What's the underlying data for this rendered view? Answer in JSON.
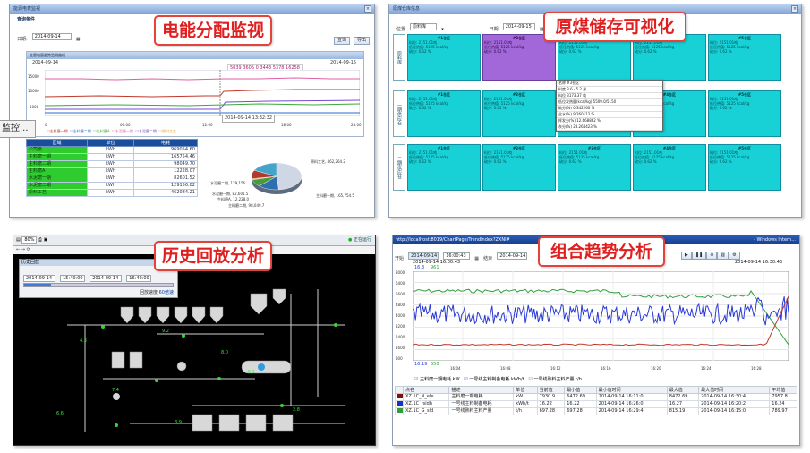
{
  "panel1": {
    "window_title": "能源电表监视",
    "sub_title": "查询条件",
    "date_label": "日期:",
    "date_value": "2014-09-14",
    "btn_query": "查询",
    "btn_export": "导出",
    "chart_title": "主要电量趋势监测曲线",
    "chart_date_left": "2014-09-14",
    "chart_date_right": "2014-09-15",
    "readout": "5839  3605  0  3443  5378  16258",
    "y_ticks": [
      "15000",
      "10000",
      "5000"
    ],
    "x_ticks": [
      "0",
      "06:00",
      "12:00",
      "18:00",
      "24:00"
    ],
    "cursor_time": "2014-09-14 13:32:32",
    "legend": [
      "主料磨一期",
      "主料磨二期",
      "生料磨A",
      "水泥磨一期",
      "水泥磨二期",
      "原料工艺"
    ],
    "table_headers": [
      "区域",
      "单位",
      "电耗"
    ],
    "table_rows": [
      {
        "name": "公司级",
        "unit": "kWh",
        "value": "969054.60"
      },
      {
        "name": "主料磨一期",
        "unit": "kWh",
        "value": "165754.46"
      },
      {
        "name": "主料磨二期",
        "unit": "kWh",
        "value": "98049.70"
      },
      {
        "name": "生料磨A",
        "unit": "kWh",
        "value": "12228.07"
      },
      {
        "name": "水泥磨一期",
        "unit": "kWh",
        "value": "82601.52"
      },
      {
        "name": "水泥磨二期",
        "unit": "kWh",
        "value": "129156.82"
      },
      {
        "name": "原料工艺",
        "unit": "kWh",
        "value": "462084.21"
      }
    ],
    "pie_labels": [
      "原料工艺, 462,264.2",
      "水泥磨二期, 129,156",
      "水泥磨一期, 82,601.5",
      "生料磨A, 12,228.0",
      "主料磨二期, 98,049.7",
      "主料磨一期, 165,754.5"
    ],
    "pie_colors": [
      "#cfd6e4",
      "#2f6fb0",
      "#4a9a3e",
      "#e0a22a",
      "#b03a2e",
      "#47a4c9"
    ],
    "pie_values": [
      462264.2,
      129156,
      82601.5,
      12228.0,
      98049.7,
      165754.5
    ],
    "callout": "电能分配监视"
  },
  "side_tab": "监控...",
  "panel2": {
    "window_title": "原煤仓库信息",
    "label_site": "位置",
    "site_value": "原料库",
    "label_date": "日期",
    "date_value": "2014-09-15",
    "btn": "查询",
    "callout": "原煤储存可视化",
    "row_headers": [
      "原料库",
      "一期供应仓",
      "二期供应仓"
    ],
    "cells": [
      [
        "#1仓区",
        "#2仓区",
        "#3仓区",
        "#4仓区",
        "#5仓区"
      ],
      [
        "#1仓区",
        "#2仓区",
        "#3仓区",
        "#4仓区",
        "#5仓区"
      ],
      [
        "#1仓区",
        "#2仓区",
        "#3仓区",
        "#4仓区",
        "#5仓区"
      ]
    ],
    "cell_lines": [
      "料位: 2151.01吨",
      "低位热值: 5125 kcal/kg",
      "硫分: 0.62 %"
    ],
    "popup": [
      "名称  #3仓区",
      "料度  3.6 - 5.2 米",
      "料位  3173.37 吨",
      "低位发热量(kcal/kg)  5509.0/5150",
      "硫分(%)  0.342260 %",
      "全水(%)  9.260112 %",
      "挥发分(%)  12.668862 %",
      "灰分(%)  28.264423 %"
    ]
  },
  "panel3": {
    "zoom": "80%",
    "right_status": "正在运行",
    "title": "历史回放",
    "date_value": "2014-09-14",
    "time_start": "15:40:00",
    "time_end": "16:40:00",
    "speed_label": "回放速度",
    "speed_value": "60倍速",
    "callout": "历史回放分析",
    "small_labels": [
      "4.3",
      "9.2",
      "5.1",
      "7.4",
      "2.8",
      "6.6",
      "8.0",
      "3.9"
    ]
  },
  "panel4": {
    "url": "http://localhost:8019/ChartPage/TrendIndex?ZXNI#",
    "browser_tail": "- Windows Intern...",
    "start_date": "2014-09-14",
    "start_time": "16:00:43",
    "end_label": "结束",
    "end_date": "2014-09-14",
    "time_left": "2014-09-14 16:00:43",
    "time_right": "2014-09-14 16:30:43",
    "top_val": "16.3",
    "top_val2": "961",
    "bottom_val": "16.19",
    "bottom_val2": "650",
    "y_ticks": [
      "8000",
      "6400",
      "5600",
      "4800",
      "4000",
      "3200",
      "2400",
      "1600",
      "800"
    ],
    "x_ticks": [
      "16:04",
      "16:08",
      "16:12",
      "16:16",
      "16:20",
      "16:24",
      "16:28"
    ],
    "legend": [
      "主料磨一期电耗  kW",
      "一号线主料制备电耗  kWh/t",
      "一号线熟料主料产量  t/h"
    ],
    "legend_colors": [
      "#c0392b",
      "#2a3ad6",
      "#2e9e3a"
    ],
    "callout": "组合趋势分析",
    "table_headers": [
      "点名",
      "描述",
      "单位",
      "当前值",
      "最小值",
      "最小值时间",
      "最大值",
      "最大值时间",
      "平均值"
    ],
    "table_rows": [
      {
        "color": "#7a1212",
        "cells": [
          "XZ.1C_N_ele",
          "主料磨一期电耗",
          "kW",
          "7930.9",
          "6472.69",
          "2014-09-14 16:11:0",
          "8472.69",
          "2014-09-14 16:30:4",
          "7957.8"
        ]
      },
      {
        "color": "#1a2fd0",
        "cells": [
          "XZ.1C_rsldh",
          "一号线主料制备电耗",
          "kWh/t",
          "16.22",
          "16.22",
          "2014-09-14 16:26:0",
          "16.27",
          "2014-09-14 16:20:2",
          "16.24"
        ]
      },
      {
        "color": "#2e9e3a",
        "cells": [
          "XZ.1C_G_sld",
          "一号线熟料主料产量",
          "t/h",
          "697.28",
          "697.28",
          "2014-09-14 16:29:4",
          "815.19",
          "2014-09-14 16:15:0",
          "789.97"
        ]
      }
    ]
  }
}
